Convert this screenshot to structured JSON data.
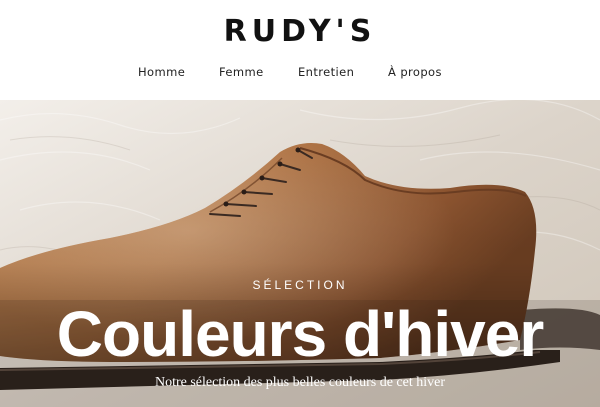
{
  "brand": {
    "name": "RUDY'S"
  },
  "nav": {
    "items": [
      {
        "label": "Homme"
      },
      {
        "label": "Femme"
      },
      {
        "label": "Entretien"
      },
      {
        "label": "À propos"
      }
    ]
  },
  "hero": {
    "kicker": "SÉLECTION",
    "title": "Couleurs d'hiver",
    "subtitle": "Notre sélection des plus belles couleurs de cet hiver"
  }
}
